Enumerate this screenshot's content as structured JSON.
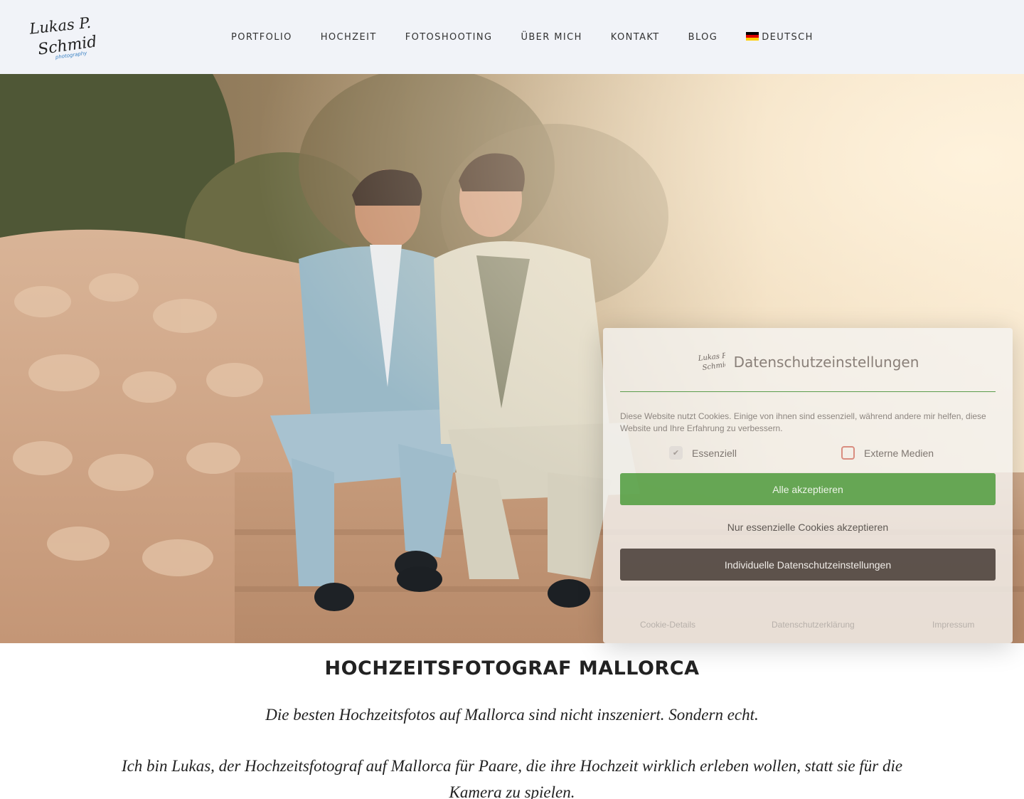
{
  "header": {
    "logo_text_line1": "Lukas P.",
    "logo_text_line2": "Schmidt",
    "logo_text_line3": "photography",
    "nav": [
      {
        "label": "PORTFOLIO"
      },
      {
        "label": "HOCHZEIT"
      },
      {
        "label": "FOTOSHOOTING"
      },
      {
        "label": "ÜBER MICH"
      },
      {
        "label": "KONTAKT"
      },
      {
        "label": "BLOG"
      },
      {
        "label": "DEUTSCH",
        "icon": "flag-de-icon"
      }
    ]
  },
  "hero": {
    "image": "wedding-couple-photo"
  },
  "cookie_dialog": {
    "title": "Datenschutzeinstellungen",
    "description": "Diese Website nutzt Cookies. Einige von ihnen sind essenziell, während andere mir helfen, diese Website und Ihre Erfahrung zu verbessern.",
    "options": [
      {
        "label": "Essenziell",
        "checked": true
      },
      {
        "label": "Externe Medien",
        "checked": false
      }
    ],
    "accept_all": "Alle akzeptieren",
    "accept_essential": "Nur essenzielle Cookies akzeptieren",
    "individual": "Individuelle Datenschutzeinstellungen",
    "links": {
      "details": "Cookie-Details",
      "privacy": "Datenschutzerklärung",
      "imprint": "Impressum"
    },
    "colors": {
      "accent_green": "#489836",
      "dark_button": "#463a34"
    }
  },
  "content": {
    "heading": "HOCHZEITSFOTOGRAF MALLORCA",
    "tagline": "Die besten Hochzeitsfotos auf Mallorca sind nicht inszeniert. Sondern echt.",
    "paragraph": "Ich bin Lukas, der Hochzeitsfotograf auf Mallorca für Paare, die ihre Hochzeit wirklich erleben wollen, statt sie für die Kamera zu spielen."
  }
}
